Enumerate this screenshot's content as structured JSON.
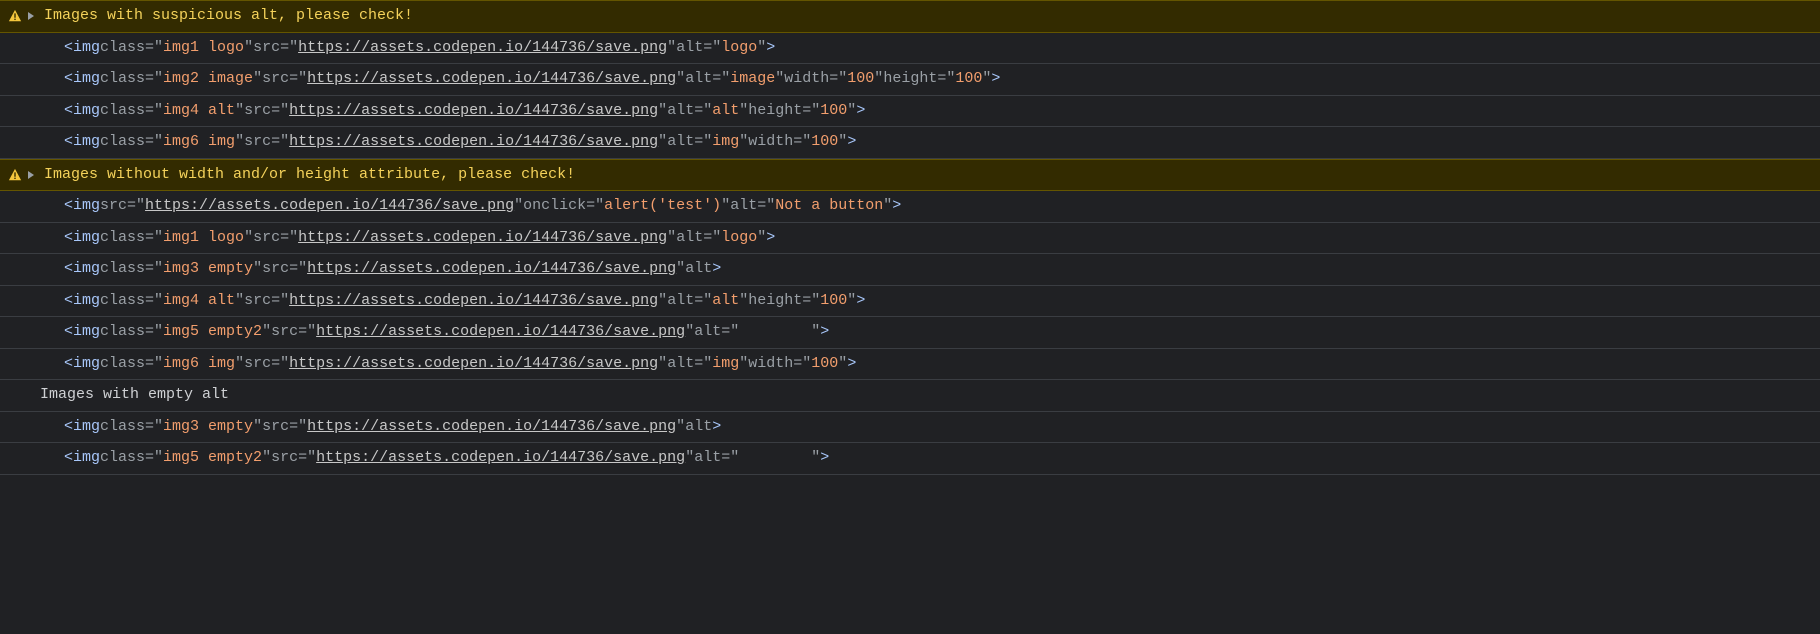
{
  "sections": [
    {
      "type": "warn",
      "title": "Images with suspicious alt, please check!",
      "rows": [
        {
          "tag": "img",
          "attrs": [
            [
              "class",
              "img1 logo"
            ],
            [
              "src",
              "https://assets.codepen.io/144736/save.png",
              "url"
            ],
            [
              "alt",
              "logo"
            ]
          ]
        },
        {
          "tag": "img",
          "attrs": [
            [
              "class",
              "img2 image"
            ],
            [
              "src",
              "https://assets.codepen.io/144736/save.png",
              "url"
            ],
            [
              "alt",
              "image"
            ],
            [
              "width",
              "100"
            ],
            [
              "height",
              "100"
            ]
          ]
        },
        {
          "tag": "img",
          "attrs": [
            [
              "class",
              "img4 alt"
            ],
            [
              "src",
              "https://assets.codepen.io/144736/save.png",
              "url"
            ],
            [
              "alt",
              "alt"
            ],
            [
              "height",
              "100"
            ]
          ]
        },
        {
          "tag": "img",
          "attrs": [
            [
              "class",
              "img6 img"
            ],
            [
              "src",
              "https://assets.codepen.io/144736/save.png",
              "url"
            ],
            [
              "alt",
              "img"
            ],
            [
              "width",
              "100"
            ]
          ]
        }
      ]
    },
    {
      "type": "warn",
      "title": "Images without width and/or height attribute, please check!",
      "rows": [
        {
          "tag": "img",
          "attrs": [
            [
              "src",
              "https://assets.codepen.io/144736/save.png",
              "url"
            ],
            [
              "onclick",
              "alert('test')"
            ],
            [
              "alt",
              "Not a button"
            ]
          ]
        },
        {
          "tag": "img",
          "attrs": [
            [
              "class",
              "img1 logo"
            ],
            [
              "src",
              "https://assets.codepen.io/144736/save.png",
              "url"
            ],
            [
              "alt",
              "logo"
            ]
          ]
        },
        {
          "tag": "img",
          "attrs": [
            [
              "class",
              "img3 empty"
            ],
            [
              "src",
              "https://assets.codepen.io/144736/save.png",
              "url"
            ],
            [
              "alt",
              null
            ]
          ]
        },
        {
          "tag": "img",
          "attrs": [
            [
              "class",
              "img4 alt"
            ],
            [
              "src",
              "https://assets.codepen.io/144736/save.png",
              "url"
            ],
            [
              "alt",
              "alt"
            ],
            [
              "height",
              "100"
            ]
          ]
        },
        {
          "tag": "img",
          "attrs": [
            [
              "class",
              "img5 empty2"
            ],
            [
              "src",
              "https://assets.codepen.io/144736/save.png",
              "url"
            ],
            [
              "alt",
              "        "
            ]
          ]
        },
        {
          "tag": "img",
          "attrs": [
            [
              "class",
              "img6 img"
            ],
            [
              "src",
              "https://assets.codepen.io/144736/save.png",
              "url"
            ],
            [
              "alt",
              "img"
            ],
            [
              "width",
              "100"
            ]
          ]
        }
      ]
    },
    {
      "type": "plain",
      "title": "Images with empty alt",
      "rows": [
        {
          "tag": "img",
          "attrs": [
            [
              "class",
              "img3 empty"
            ],
            [
              "src",
              "https://assets.codepen.io/144736/save.png",
              "url"
            ],
            [
              "alt",
              null
            ]
          ]
        },
        {
          "tag": "img",
          "attrs": [
            [
              "class",
              "img5 empty2"
            ],
            [
              "src",
              "https://assets.codepen.io/144736/save.png",
              "url"
            ],
            [
              "alt",
              "        "
            ]
          ]
        }
      ]
    }
  ]
}
